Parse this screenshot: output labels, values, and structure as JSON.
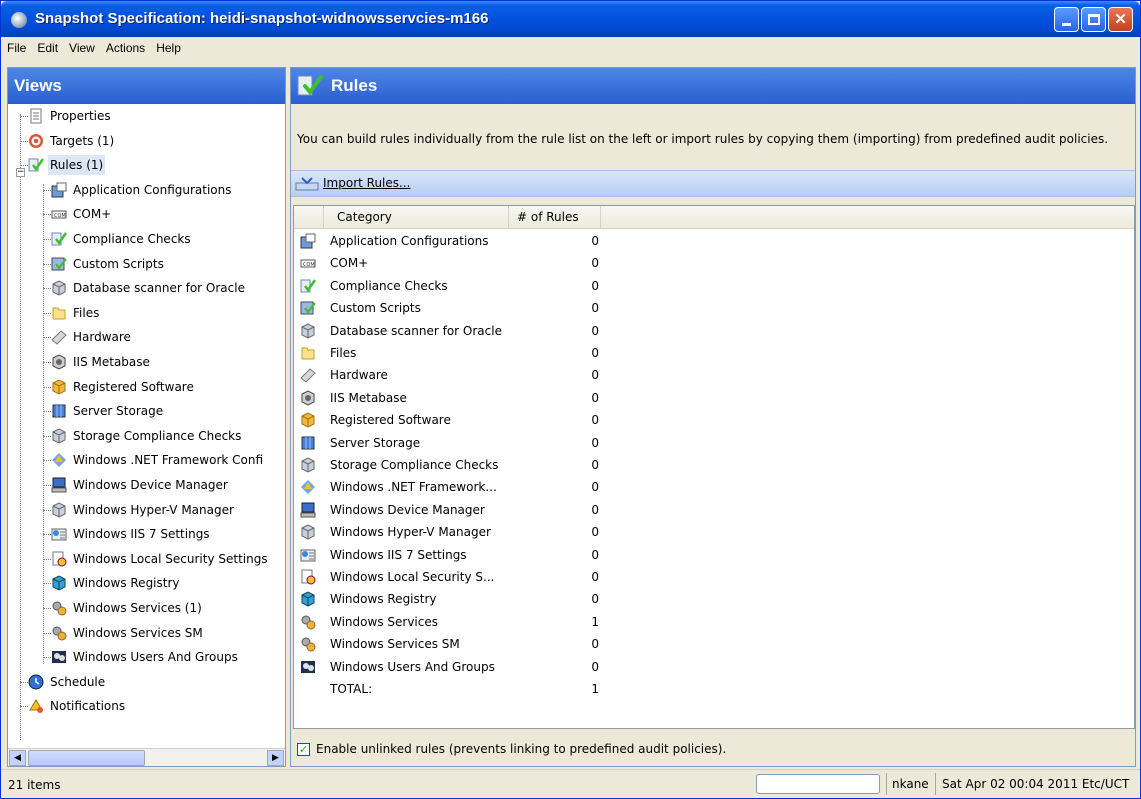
{
  "window": {
    "title": "Snapshot Specification: heidi-snapshot-widnowsservcies-m166"
  },
  "menu": [
    "File",
    "Edit",
    "View",
    "Actions",
    "Help"
  ],
  "views": {
    "title": "Views",
    "tree": [
      {
        "label": "Properties",
        "icon": "properties-icon"
      },
      {
        "label": "Targets (1)",
        "icon": "target-icon"
      },
      {
        "label": "Rules (1)",
        "icon": "rules-icon",
        "selected": true
      },
      {
        "label": "Application Configurations",
        "icon": "app-config-icon"
      },
      {
        "label": "COM+",
        "icon": "com-icon"
      },
      {
        "label": "Compliance Checks",
        "icon": "compliance-icon"
      },
      {
        "label": "Custom Scripts",
        "icon": "script-icon"
      },
      {
        "label": "Database scanner for Oracle",
        "icon": "database-icon"
      },
      {
        "label": "Files",
        "icon": "folder-icon"
      },
      {
        "label": "Hardware",
        "icon": "hardware-icon"
      },
      {
        "label": "IIS Metabase",
        "icon": "iis-icon"
      },
      {
        "label": "Registered Software",
        "icon": "software-icon"
      },
      {
        "label": "Server Storage",
        "icon": "storage-icon"
      },
      {
        "label": "Storage Compliance Checks",
        "icon": "storage-compliance-icon"
      },
      {
        "label": "Windows .NET Framework Confi",
        "icon": "dotnet-icon"
      },
      {
        "label": "Windows Device Manager",
        "icon": "device-manager-icon"
      },
      {
        "label": "Windows Hyper-V Manager",
        "icon": "hyperv-icon"
      },
      {
        "label": "Windows IIS 7 Settings",
        "icon": "iis7-icon"
      },
      {
        "label": "Windows Local Security Settings",
        "icon": "security-icon"
      },
      {
        "label": "Windows Registry",
        "icon": "registry-icon"
      },
      {
        "label": "Windows Services (1)",
        "icon": "services-icon"
      },
      {
        "label": "Windows Services SM",
        "icon": "services-icon"
      },
      {
        "label": "Windows Users And Groups",
        "icon": "users-icon"
      },
      {
        "label": "Schedule",
        "icon": "schedule-icon"
      },
      {
        "label": "Notifications",
        "icon": "notifications-icon"
      }
    ]
  },
  "rules": {
    "title": "Rules",
    "description": "You can build rules individually from the rule list on the left or import rules by copying them (importing) from predefined audit policies.",
    "import_label": "Import Rules...",
    "columns": [
      "Category",
      "# of Rules"
    ],
    "rows": [
      {
        "category": "Application Configurations",
        "count": "0",
        "icon": "app-config-icon"
      },
      {
        "category": "COM+",
        "count": "0",
        "icon": "com-icon"
      },
      {
        "category": "Compliance Checks",
        "count": "0",
        "icon": "compliance-icon"
      },
      {
        "category": "Custom Scripts",
        "count": "0",
        "icon": "script-icon"
      },
      {
        "category": "Database scanner for Oracle",
        "count": "0",
        "icon": "database-icon"
      },
      {
        "category": "Files",
        "count": "0",
        "icon": "folder-icon"
      },
      {
        "category": "Hardware",
        "count": "0",
        "icon": "hardware-icon"
      },
      {
        "category": "IIS Metabase",
        "count": "0",
        "icon": "iis-icon"
      },
      {
        "category": "Registered Software",
        "count": "0",
        "icon": "software-icon"
      },
      {
        "category": "Server Storage",
        "count": "0",
        "icon": "storage-icon"
      },
      {
        "category": "Storage Compliance Checks",
        "count": "0",
        "icon": "storage-compliance-icon"
      },
      {
        "category": "Windows .NET Framework...",
        "count": "0",
        "icon": "dotnet-icon"
      },
      {
        "category": "Windows Device Manager",
        "count": "0",
        "icon": "device-manager-icon"
      },
      {
        "category": "Windows Hyper-V Manager",
        "count": "0",
        "icon": "hyperv-icon"
      },
      {
        "category": "Windows IIS 7 Settings",
        "count": "0",
        "icon": "iis7-icon"
      },
      {
        "category": "Windows Local Security S...",
        "count": "0",
        "icon": "security-icon"
      },
      {
        "category": "Windows Registry",
        "count": "0",
        "icon": "registry-icon"
      },
      {
        "category": "Windows Services",
        "count": "1",
        "icon": "services-icon"
      },
      {
        "category": "Windows Services SM",
        "count": "0",
        "icon": "services-icon"
      },
      {
        "category": "Windows Users And Groups",
        "count": "0",
        "icon": "users-icon"
      },
      {
        "category": "TOTAL:",
        "count": "1",
        "icon": ""
      }
    ],
    "enable_unlinked_label": "Enable unlinked rules (prevents linking to predefined audit policies).",
    "enable_unlinked_checked": true
  },
  "status": {
    "items": "21 items",
    "user": "nkane",
    "datetime": "Sat Apr 02 00:04 2011 Etc/UCT"
  },
  "colors": {
    "titlebar": "#0352dd",
    "panel_header": "#2a5fd0",
    "selection": "#dde6f5",
    "window_bg": "#ece9d8"
  }
}
